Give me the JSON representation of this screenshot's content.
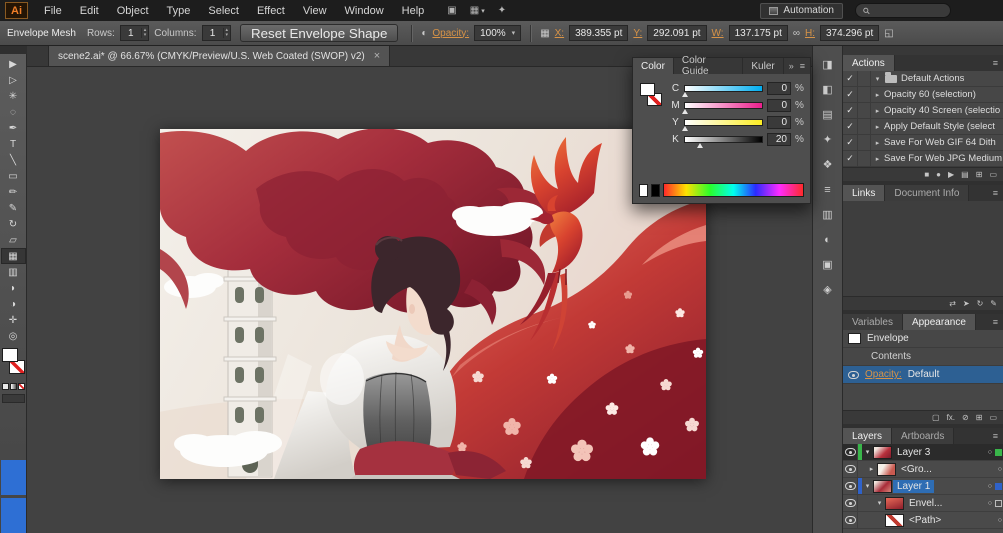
{
  "app": {
    "logo": "Ai"
  },
  "menubar": {
    "items": [
      "File",
      "Edit",
      "Object",
      "Type",
      "Select",
      "Effect",
      "View",
      "Window",
      "Help"
    ],
    "workspace": "Automation",
    "search_placeholder": ""
  },
  "menubar_icons": [
    {
      "name": "bridge",
      "glyph": "▣"
    },
    {
      "name": "arrange-documents",
      "glyph": "▦"
    },
    {
      "name": "cs-live",
      "glyph": "✦"
    }
  ],
  "glyphs": {
    "chevron_down": "▾",
    "chevron_up": "▴",
    "check": "✓",
    "menu": "≡",
    "double_chevron": "»",
    "link": "∞",
    "transparency": "◐",
    "grid": "▦",
    "target": "○",
    "transform": "◱"
  },
  "control_bar": {
    "title": "Envelope Mesh",
    "rows_label": "Rows:",
    "rows_value": "1",
    "columns_label": "Columns:",
    "columns_value": "1",
    "reset_button": "Reset Envelope Shape",
    "opacity_label": "Opacity:",
    "opacity_value": "100%",
    "x_label": "X:",
    "x_value": "389.355 pt",
    "y_label": "Y:",
    "y_value": "292.091 pt",
    "w_label": "W:",
    "w_value": "137.175 pt",
    "h_label": "H:",
    "h_value": "374.296 pt"
  },
  "document_tab": {
    "title": "scene2.ai* @ 66.67% (CMYK/Preview/U.S. Web Coated (SWOP) v2)",
    "close": "×"
  },
  "tools": [
    {
      "name": "selection",
      "glyph": "▶"
    },
    {
      "name": "direct-selection",
      "glyph": "▷"
    },
    {
      "name": "magic-wand",
      "glyph": "✳"
    },
    {
      "name": "lasso",
      "glyph": "◌"
    },
    {
      "name": "pen",
      "glyph": "✒"
    },
    {
      "name": "type",
      "glyph": "T"
    },
    {
      "name": "line-segment",
      "glyph": "╲"
    },
    {
      "name": "rectangle",
      "glyph": "▭"
    },
    {
      "name": "paintbrush",
      "glyph": "✏"
    },
    {
      "name": "pencil",
      "glyph": "✎"
    },
    {
      "name": "rotate",
      "glyph": "↻"
    },
    {
      "name": "scale",
      "glyph": "▱"
    },
    {
      "name": "mesh",
      "glyph": "▦"
    },
    {
      "name": "gradient",
      "glyph": "▥"
    },
    {
      "name": "eyedropper",
      "glyph": "◗"
    },
    {
      "name": "blend",
      "glyph": "◑"
    },
    {
      "name": "hand",
      "glyph": "✛"
    },
    {
      "name": "zoom",
      "glyph": "◎"
    }
  ],
  "color_panel": {
    "tabs": [
      "Color",
      "Color Guide",
      "Kuler"
    ],
    "sliders": [
      {
        "label": "C",
        "value": "0",
        "unit": "%"
      },
      {
        "label": "M",
        "value": "0",
        "unit": "%"
      },
      {
        "label": "Y",
        "value": "0",
        "unit": "%"
      },
      {
        "label": "K",
        "value": "20",
        "unit": "%"
      }
    ]
  },
  "dock_icons": [
    {
      "name": "color",
      "glyph": "◨"
    },
    {
      "name": "color-guide",
      "glyph": "◧"
    },
    {
      "name": "swatches",
      "glyph": "▤"
    },
    {
      "name": "brushes",
      "glyph": "✦"
    },
    {
      "name": "symbols",
      "glyph": "❖"
    },
    {
      "name": "stroke",
      "glyph": "≡"
    },
    {
      "name": "gradient",
      "glyph": "▥"
    },
    {
      "name": "transparency",
      "glyph": "◐"
    },
    {
      "name": "graphic-styles",
      "glyph": "▣"
    },
    {
      "name": "navigator",
      "glyph": "◈"
    }
  ],
  "actions_panel": {
    "title": "Actions",
    "set_name": "Default Actions",
    "items": [
      "Opacity 60 (selection)",
      "Opacity 40 Screen (selectio",
      "Apply Default Style (select",
      "Save For Web GIF 64 Dith",
      "Save For Web JPG Medium"
    ],
    "footer_icons": [
      {
        "name": "stop",
        "glyph": "■"
      },
      {
        "name": "record",
        "glyph": "●"
      },
      {
        "name": "play",
        "glyph": "▶"
      },
      {
        "name": "new-set",
        "glyph": "▤"
      },
      {
        "name": "new-action",
        "glyph": "⊞"
      },
      {
        "name": "delete",
        "glyph": "▭"
      }
    ]
  },
  "links_panel": {
    "tabs": [
      "Links",
      "Document Info"
    ],
    "footer_icons": [
      {
        "name": "relink",
        "glyph": "⇄"
      },
      {
        "name": "go-to-link",
        "glyph": "➤"
      },
      {
        "name": "update-link",
        "glyph": "↻"
      },
      {
        "name": "edit-original",
        "glyph": "✎"
      }
    ]
  },
  "appearance_panel": {
    "tabs": [
      "Variables",
      "Appearance"
    ],
    "envelope_label": "Envelope",
    "contents_label": "Contents",
    "opacity_label": "Opacity:",
    "opacity_value": "Default",
    "fx_label": "fx."
  },
  "layers_panel": {
    "tabs": [
      "Layers",
      "Artboards"
    ],
    "rows": [
      {
        "label": "Layer 3",
        "arrow": "▾"
      },
      {
        "label": "<Gro...",
        "arrow": "▸"
      },
      {
        "label": "Layer 1",
        "arrow": "▾"
      },
      {
        "label": "Envel...",
        "arrow": "▾"
      },
      {
        "label": "<Path>",
        "arrow": ""
      }
    ]
  },
  "colors": {
    "accent_orange": "#d79347",
    "selection_blue": "#2e6db4",
    "layer_green": "#39b54a",
    "layer_blue": "#2f62c9",
    "artwork_red": "#c0392b"
  }
}
